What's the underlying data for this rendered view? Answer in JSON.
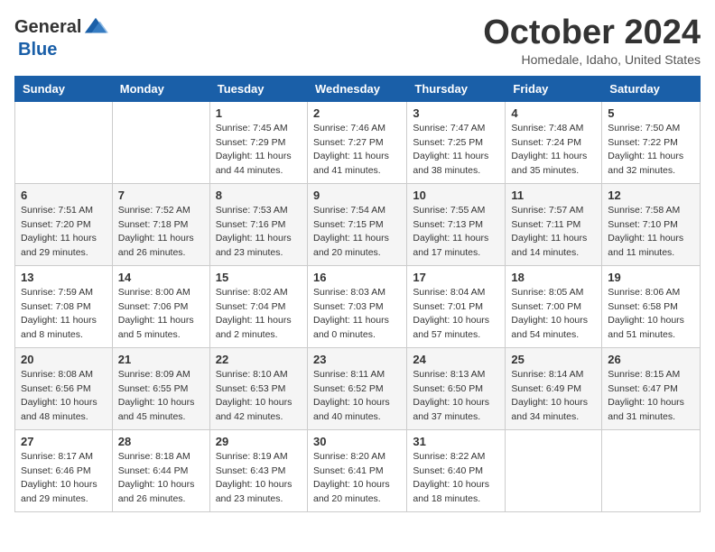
{
  "header": {
    "logo_general": "General",
    "logo_blue": "Blue",
    "month": "October 2024",
    "location": "Homedale, Idaho, United States"
  },
  "weekdays": [
    "Sunday",
    "Monday",
    "Tuesday",
    "Wednesday",
    "Thursday",
    "Friday",
    "Saturday"
  ],
  "weeks": [
    [
      {
        "day": "",
        "sunrise": "",
        "sunset": "",
        "daylight": ""
      },
      {
        "day": "",
        "sunrise": "",
        "sunset": "",
        "daylight": ""
      },
      {
        "day": "1",
        "sunrise": "Sunrise: 7:45 AM",
        "sunset": "Sunset: 7:29 PM",
        "daylight": "Daylight: 11 hours and 44 minutes."
      },
      {
        "day": "2",
        "sunrise": "Sunrise: 7:46 AM",
        "sunset": "Sunset: 7:27 PM",
        "daylight": "Daylight: 11 hours and 41 minutes."
      },
      {
        "day": "3",
        "sunrise": "Sunrise: 7:47 AM",
        "sunset": "Sunset: 7:25 PM",
        "daylight": "Daylight: 11 hours and 38 minutes."
      },
      {
        "day": "4",
        "sunrise": "Sunrise: 7:48 AM",
        "sunset": "Sunset: 7:24 PM",
        "daylight": "Daylight: 11 hours and 35 minutes."
      },
      {
        "day": "5",
        "sunrise": "Sunrise: 7:50 AM",
        "sunset": "Sunset: 7:22 PM",
        "daylight": "Daylight: 11 hours and 32 minutes."
      }
    ],
    [
      {
        "day": "6",
        "sunrise": "Sunrise: 7:51 AM",
        "sunset": "Sunset: 7:20 PM",
        "daylight": "Daylight: 11 hours and 29 minutes."
      },
      {
        "day": "7",
        "sunrise": "Sunrise: 7:52 AM",
        "sunset": "Sunset: 7:18 PM",
        "daylight": "Daylight: 11 hours and 26 minutes."
      },
      {
        "day": "8",
        "sunrise": "Sunrise: 7:53 AM",
        "sunset": "Sunset: 7:16 PM",
        "daylight": "Daylight: 11 hours and 23 minutes."
      },
      {
        "day": "9",
        "sunrise": "Sunrise: 7:54 AM",
        "sunset": "Sunset: 7:15 PM",
        "daylight": "Daylight: 11 hours and 20 minutes."
      },
      {
        "day": "10",
        "sunrise": "Sunrise: 7:55 AM",
        "sunset": "Sunset: 7:13 PM",
        "daylight": "Daylight: 11 hours and 17 minutes."
      },
      {
        "day": "11",
        "sunrise": "Sunrise: 7:57 AM",
        "sunset": "Sunset: 7:11 PM",
        "daylight": "Daylight: 11 hours and 14 minutes."
      },
      {
        "day": "12",
        "sunrise": "Sunrise: 7:58 AM",
        "sunset": "Sunset: 7:10 PM",
        "daylight": "Daylight: 11 hours and 11 minutes."
      }
    ],
    [
      {
        "day": "13",
        "sunrise": "Sunrise: 7:59 AM",
        "sunset": "Sunset: 7:08 PM",
        "daylight": "Daylight: 11 hours and 8 minutes."
      },
      {
        "day": "14",
        "sunrise": "Sunrise: 8:00 AM",
        "sunset": "Sunset: 7:06 PM",
        "daylight": "Daylight: 11 hours and 5 minutes."
      },
      {
        "day": "15",
        "sunrise": "Sunrise: 8:02 AM",
        "sunset": "Sunset: 7:04 PM",
        "daylight": "Daylight: 11 hours and 2 minutes."
      },
      {
        "day": "16",
        "sunrise": "Sunrise: 8:03 AM",
        "sunset": "Sunset: 7:03 PM",
        "daylight": "Daylight: 11 hours and 0 minutes."
      },
      {
        "day": "17",
        "sunrise": "Sunrise: 8:04 AM",
        "sunset": "Sunset: 7:01 PM",
        "daylight": "Daylight: 10 hours and 57 minutes."
      },
      {
        "day": "18",
        "sunrise": "Sunrise: 8:05 AM",
        "sunset": "Sunset: 7:00 PM",
        "daylight": "Daylight: 10 hours and 54 minutes."
      },
      {
        "day": "19",
        "sunrise": "Sunrise: 8:06 AM",
        "sunset": "Sunset: 6:58 PM",
        "daylight": "Daylight: 10 hours and 51 minutes."
      }
    ],
    [
      {
        "day": "20",
        "sunrise": "Sunrise: 8:08 AM",
        "sunset": "Sunset: 6:56 PM",
        "daylight": "Daylight: 10 hours and 48 minutes."
      },
      {
        "day": "21",
        "sunrise": "Sunrise: 8:09 AM",
        "sunset": "Sunset: 6:55 PM",
        "daylight": "Daylight: 10 hours and 45 minutes."
      },
      {
        "day": "22",
        "sunrise": "Sunrise: 8:10 AM",
        "sunset": "Sunset: 6:53 PM",
        "daylight": "Daylight: 10 hours and 42 minutes."
      },
      {
        "day": "23",
        "sunrise": "Sunrise: 8:11 AM",
        "sunset": "Sunset: 6:52 PM",
        "daylight": "Daylight: 10 hours and 40 minutes."
      },
      {
        "day": "24",
        "sunrise": "Sunrise: 8:13 AM",
        "sunset": "Sunset: 6:50 PM",
        "daylight": "Daylight: 10 hours and 37 minutes."
      },
      {
        "day": "25",
        "sunrise": "Sunrise: 8:14 AM",
        "sunset": "Sunset: 6:49 PM",
        "daylight": "Daylight: 10 hours and 34 minutes."
      },
      {
        "day": "26",
        "sunrise": "Sunrise: 8:15 AM",
        "sunset": "Sunset: 6:47 PM",
        "daylight": "Daylight: 10 hours and 31 minutes."
      }
    ],
    [
      {
        "day": "27",
        "sunrise": "Sunrise: 8:17 AM",
        "sunset": "Sunset: 6:46 PM",
        "daylight": "Daylight: 10 hours and 29 minutes."
      },
      {
        "day": "28",
        "sunrise": "Sunrise: 8:18 AM",
        "sunset": "Sunset: 6:44 PM",
        "daylight": "Daylight: 10 hours and 26 minutes."
      },
      {
        "day": "29",
        "sunrise": "Sunrise: 8:19 AM",
        "sunset": "Sunset: 6:43 PM",
        "daylight": "Daylight: 10 hours and 23 minutes."
      },
      {
        "day": "30",
        "sunrise": "Sunrise: 8:20 AM",
        "sunset": "Sunset: 6:41 PM",
        "daylight": "Daylight: 10 hours and 20 minutes."
      },
      {
        "day": "31",
        "sunrise": "Sunrise: 8:22 AM",
        "sunset": "Sunset: 6:40 PM",
        "daylight": "Daylight: 10 hours and 18 minutes."
      },
      {
        "day": "",
        "sunrise": "",
        "sunset": "",
        "daylight": ""
      },
      {
        "day": "",
        "sunrise": "",
        "sunset": "",
        "daylight": ""
      }
    ]
  ]
}
